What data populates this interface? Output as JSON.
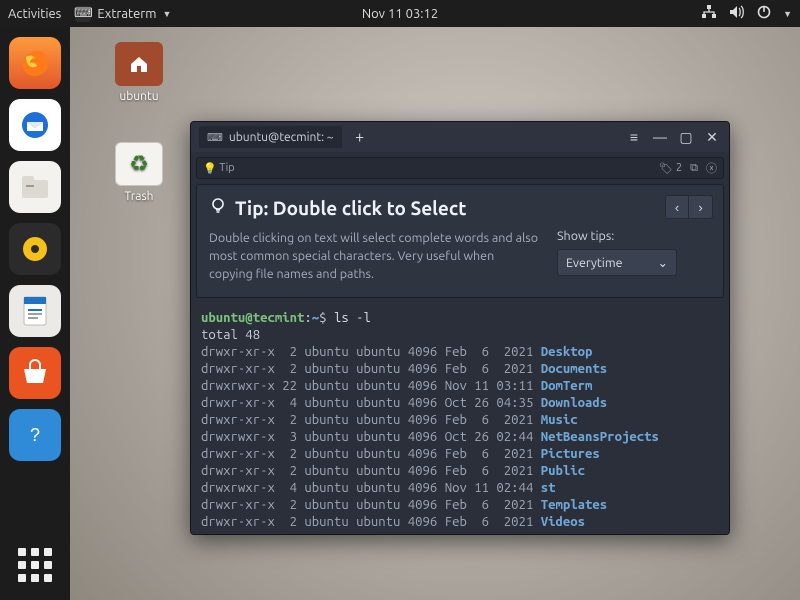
{
  "panel": {
    "activities": "Activities",
    "app_name": "Extraterm",
    "clock": "Nov 11  03:12"
  },
  "desktop_icons": {
    "home": "ubuntu",
    "trash": "Trash"
  },
  "window": {
    "tab_title": "ubuntu@tecmint: ~"
  },
  "tip_strip": {
    "label": "Tip",
    "count": "2"
  },
  "tip_panel": {
    "heading": "Tip: Double click to Select",
    "body": "Double clicking on text will select complete words and also most common special characters. Very useful when copying file names and paths.",
    "show_tips_label": "Show tips:",
    "show_tips_value": "Everytime"
  },
  "terminal": {
    "user": "ubuntu@tecmint",
    "path": "~",
    "command": "ls -l",
    "total_line": "total 48",
    "rows": [
      {
        "perm": "drwxr-xr-x",
        "n": " 2",
        "own": "ubuntu ubuntu",
        "size": "4096",
        "date": "Feb  6  2021",
        "name": "Desktop"
      },
      {
        "perm": "drwxr-xr-x",
        "n": " 2",
        "own": "ubuntu ubuntu",
        "size": "4096",
        "date": "Feb  6  2021",
        "name": "Documents"
      },
      {
        "perm": "drwxrwxr-x",
        "n": "22",
        "own": "ubuntu ubuntu",
        "size": "4096",
        "date": "Nov 11 03:11",
        "name": "DomTerm"
      },
      {
        "perm": "drwxr-xr-x",
        "n": " 4",
        "own": "ubuntu ubuntu",
        "size": "4096",
        "date": "Oct 26 04:35",
        "name": "Downloads"
      },
      {
        "perm": "drwxr-xr-x",
        "n": " 2",
        "own": "ubuntu ubuntu",
        "size": "4096",
        "date": "Feb  6  2021",
        "name": "Music"
      },
      {
        "perm": "drwxrwxr-x",
        "n": " 3",
        "own": "ubuntu ubuntu",
        "size": "4096",
        "date": "Oct 26 02:44",
        "name": "NetBeansProjects"
      },
      {
        "perm": "drwxr-xr-x",
        "n": " 2",
        "own": "ubuntu ubuntu",
        "size": "4096",
        "date": "Feb  6  2021",
        "name": "Pictures"
      },
      {
        "perm": "drwxr-xr-x",
        "n": " 2",
        "own": "ubuntu ubuntu",
        "size": "4096",
        "date": "Feb  6  2021",
        "name": "Public"
      },
      {
        "perm": "drwxrwxr-x",
        "n": " 4",
        "own": "ubuntu ubuntu",
        "size": "4096",
        "date": "Nov 11 02:44",
        "name": "st"
      },
      {
        "perm": "drwxr-xr-x",
        "n": " 2",
        "own": "ubuntu ubuntu",
        "size": "4096",
        "date": "Feb  6  2021",
        "name": "Templates"
      },
      {
        "perm": "drwxr-xr-x",
        "n": " 2",
        "own": "ubuntu ubuntu",
        "size": "4096",
        "date": "Feb  6  2021",
        "name": "Videos"
      }
    ]
  }
}
